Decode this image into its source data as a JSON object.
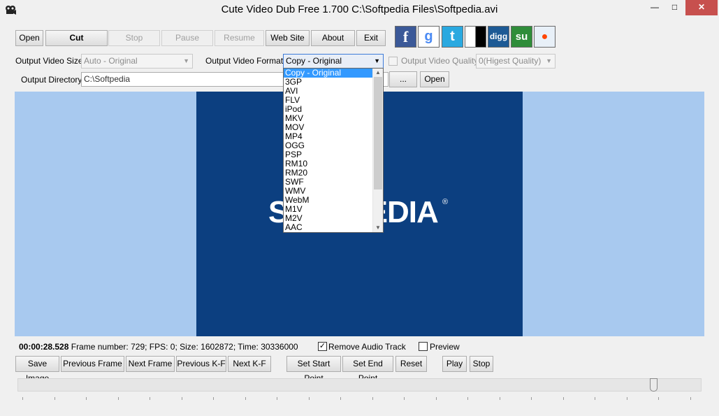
{
  "window": {
    "title": "Cute Video Dub Free 1.700  C:\\Softpedia Files\\Softpedia.avi",
    "minimize": "—",
    "maximize": "□",
    "close": "✕"
  },
  "toolbar": {
    "open": "Open",
    "cut": "Cut",
    "stop": "Stop",
    "pause": "Pause",
    "resume": "Resume",
    "website": "Web Site",
    "about": "About",
    "exit": "Exit"
  },
  "social": [
    {
      "icon": "facebook-icon",
      "glyph": "f",
      "color": "#3b5998"
    },
    {
      "icon": "google-icon",
      "glyph": "g",
      "color": "#4a8af4"
    },
    {
      "icon": "twitter-icon",
      "glyph": "t",
      "color": "#2aa9e0"
    },
    {
      "icon": "delicious-icon",
      "glyph": "",
      "color": "#d0d0d0"
    },
    {
      "icon": "digg-icon",
      "glyph": "digg",
      "color": "#1d5a95"
    },
    {
      "icon": "stumbleupon-icon",
      "glyph": "su",
      "color": "#2f8d3a"
    },
    {
      "icon": "reddit-icon",
      "glyph": "●",
      "color": "#e8f0f8"
    }
  ],
  "settings": {
    "output_size_label": "Output Video Size:",
    "output_size_value": "Auto - Original",
    "output_format_label": "Output Video Format:",
    "output_format_value": "Copy - Original",
    "output_quality_label": "Output Video Quality",
    "output_quality_value": "0(Higest Quality)",
    "output_dir_label": "Output Directory:",
    "output_dir_value": "C:\\Softpedia",
    "browse": "...",
    "open_dir": "Open"
  },
  "format_dropdown": {
    "options": [
      "Copy - Original",
      "3GP",
      "AVI",
      "FLV",
      "iPod",
      "MKV",
      "MOV",
      "MP4",
      "OGG",
      "PSP",
      "RM10",
      "RM20",
      "SWF",
      "WMV",
      "WebM",
      "M1V",
      "M2V",
      "AAC"
    ],
    "selected_index": 0
  },
  "preview": {
    "logo_text": "SOFTPEDIA",
    "logo_mark": "®"
  },
  "status": {
    "time": "00:00:28.528",
    "info": "Frame number: 729; FPS: 0; Size: 1602872; Time: 30336000",
    "remove_audio_label": "Remove Audio Track",
    "remove_audio_checked": true,
    "preview_label": "Preview",
    "preview_checked": false
  },
  "bottom_buttons": {
    "save_image": "Save Image",
    "previous_frame": "Previous Frame",
    "next_frame": "Next Frame",
    "previous_kf": "Previous K-F",
    "next_kf": "Next K-F",
    "set_start": "Set  Start Point",
    "set_end": "Set  End Point",
    "reset": "Reset",
    "play": "Play",
    "stop": "Stop"
  },
  "seek": {
    "position_fraction": 0.93
  }
}
